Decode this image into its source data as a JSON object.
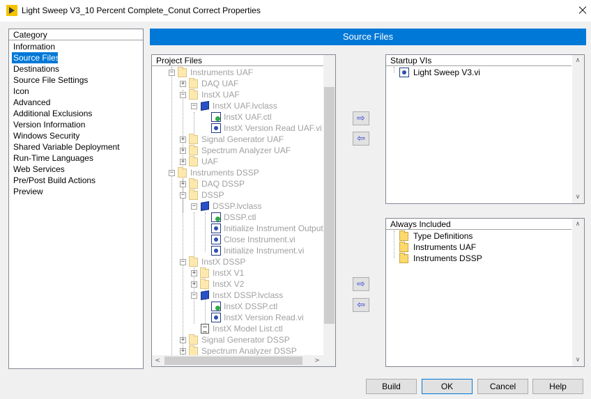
{
  "window": {
    "title": "Light Sweep V3_10 Percent Complete_Conut Correct Properties"
  },
  "category": {
    "header": "Category",
    "items": [
      "Information",
      "Source Files",
      "Destinations",
      "Source File Settings",
      "Icon",
      "Advanced",
      "Additional Exclusions",
      "Version Information",
      "Windows Security",
      "Shared Variable Deployment",
      "Run-Time Languages",
      "Web Services",
      "Pre/Post Build Actions",
      "Preview"
    ],
    "selected": "Source Files"
  },
  "section_title": "Source Files",
  "project_files": {
    "header": "Project Files",
    "rows": [
      {
        "label": "Instruments UAF",
        "icon": "folder-icon"
      },
      {
        "label": "DAQ UAF",
        "icon": "folder-icon"
      },
      {
        "label": "InstX UAF",
        "icon": "folder-icon"
      },
      {
        "label": "InstX UAF.lvclass",
        "icon": "class-icon"
      },
      {
        "label": "InstX UAF.ctl",
        "icon": "control-icon"
      },
      {
        "label": "InstX Version Read UAF.vi",
        "icon": "vi-icon"
      },
      {
        "label": "Signal Generator UAF",
        "icon": "folder-icon"
      },
      {
        "label": "Spectrum Analyzer UAF",
        "icon": "folder-icon"
      },
      {
        "label": "UAF",
        "icon": "folder-icon"
      },
      {
        "label": "Instruments DSSP",
        "icon": "folder-icon"
      },
      {
        "label": "DAQ DSSP",
        "icon": "folder-icon"
      },
      {
        "label": "DSSP",
        "icon": "folder-icon"
      },
      {
        "label": "DSSP.lvclass",
        "icon": "class-icon"
      },
      {
        "label": "DSSP.ctl",
        "icon": "control-icon"
      },
      {
        "label": "Initialize Instrument Output",
        "icon": "vi-icon"
      },
      {
        "label": "Close Instrument.vi",
        "icon": "vi-icon"
      },
      {
        "label": "Initialize Instrument.vi",
        "icon": "vi-icon"
      },
      {
        "label": "InstX DSSP",
        "icon": "folder-icon"
      },
      {
        "label": "InstX V1",
        "icon": "folder-icon"
      },
      {
        "label": "InstX V2",
        "icon": "folder-icon"
      },
      {
        "label": "InstX DSSP.lvclass",
        "icon": "class-icon"
      },
      {
        "label": "InstX DSSP.ctl",
        "icon": "control-icon"
      },
      {
        "label": "InstX Version Read.vi",
        "icon": "vi-icon"
      },
      {
        "label": "InstX Model List.ctl",
        "icon": "list-icon"
      },
      {
        "label": "Signal Generator DSSP",
        "icon": "folder-icon"
      },
      {
        "label": "Spectrum Analyzer DSSP",
        "icon": "folder-icon"
      }
    ]
  },
  "startup_vis": {
    "header": "Startup VIs",
    "items": [
      "Light Sweep V3.vi"
    ]
  },
  "always_included": {
    "header": "Always Included",
    "items": [
      "Type Definitions",
      "Instruments UAF",
      "Instruments DSSP"
    ]
  },
  "arrows": {
    "add": "⇨",
    "remove": "⇦"
  },
  "buttons": {
    "build": "Build",
    "ok": "OK",
    "cancel": "Cancel",
    "help": "Help"
  },
  "colors": {
    "accent": "#0078d7",
    "disabled_text": "#a0a0a0"
  }
}
